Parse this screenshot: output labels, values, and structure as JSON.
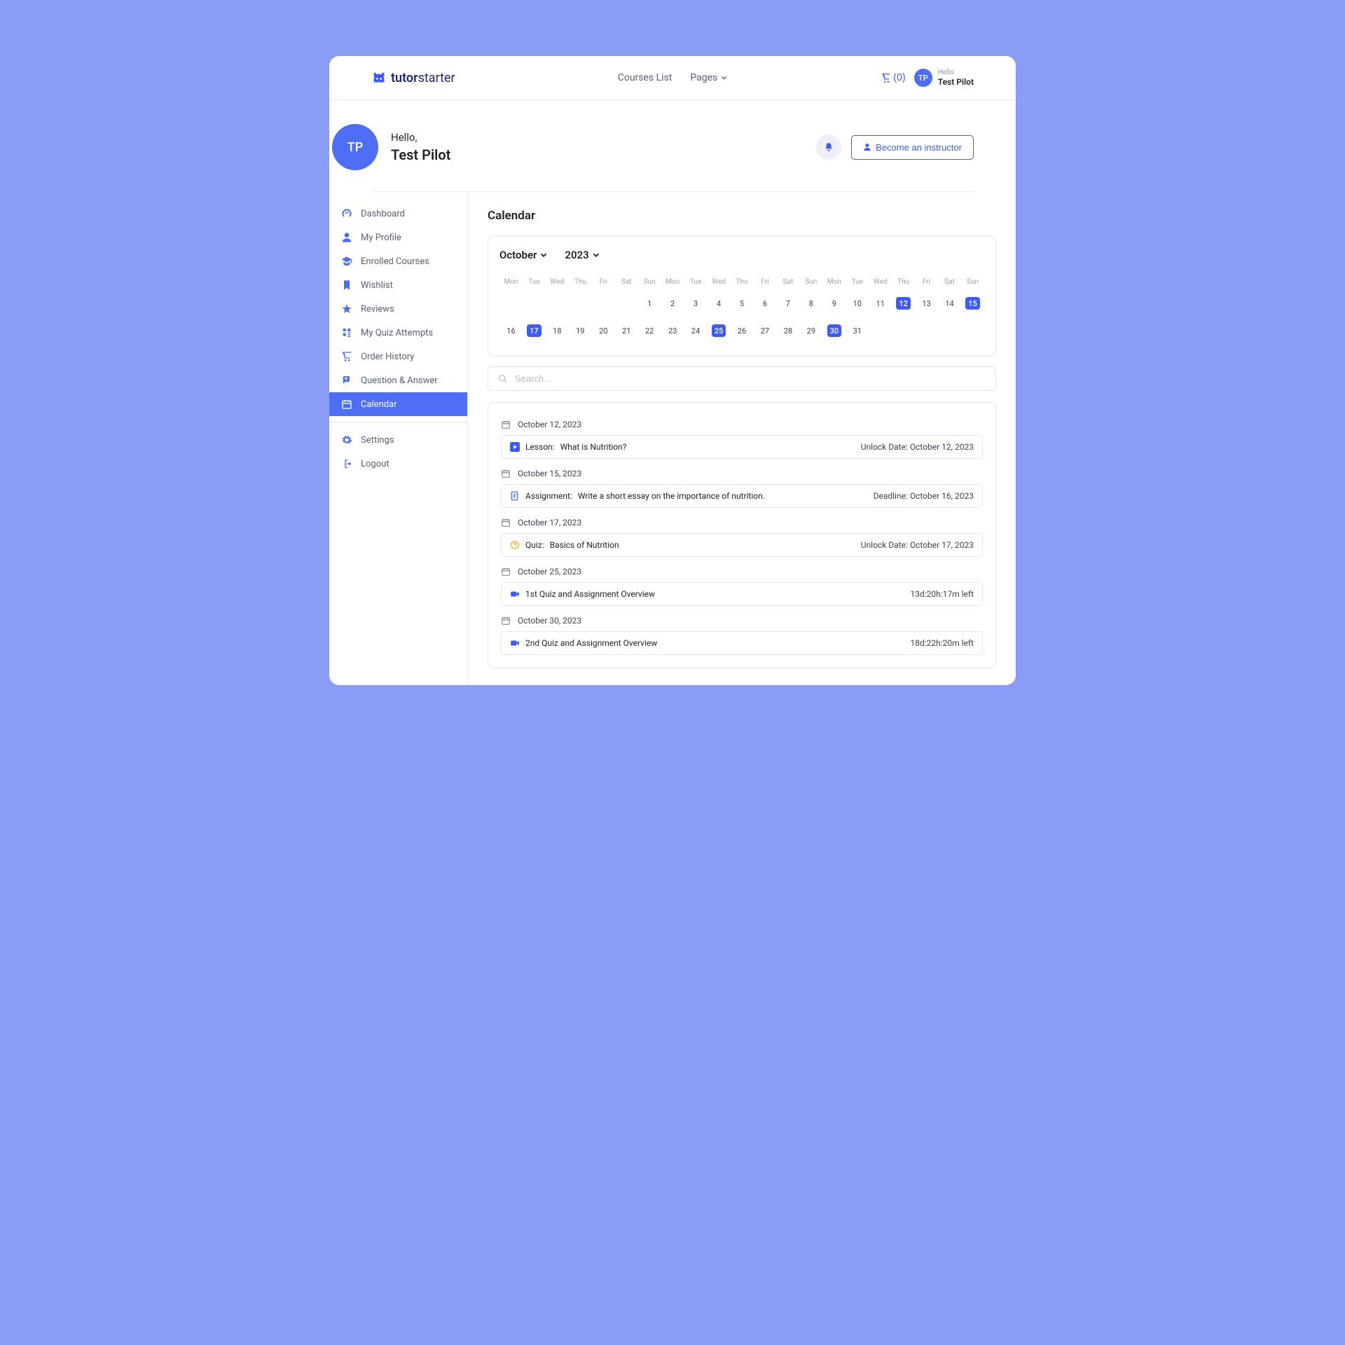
{
  "logo": {
    "bold": "tutor",
    "light": "starter"
  },
  "topnav": {
    "courses": "Courses List",
    "pages": "Pages"
  },
  "cart": {
    "count": "(0)"
  },
  "user": {
    "hello": "Hello",
    "name": "Test Pilot",
    "initials": "TP"
  },
  "profile": {
    "hello": "Hello,",
    "name": "Test Pilot",
    "initials": "TP",
    "become": "Become an instructor"
  },
  "sidebar": {
    "items": [
      {
        "label": "Dashboard"
      },
      {
        "label": "My Profile"
      },
      {
        "label": "Enrolled Courses"
      },
      {
        "label": "Wishlist"
      },
      {
        "label": "Reviews"
      },
      {
        "label": "My Quiz Attempts"
      },
      {
        "label": "Order History"
      },
      {
        "label": "Question & Answer"
      },
      {
        "label": "Calendar"
      },
      {
        "label": "Settings"
      },
      {
        "label": "Logout"
      }
    ]
  },
  "page": {
    "title": "Calendar"
  },
  "calendar": {
    "month": "October",
    "year": "2023",
    "weekdays": [
      "Mon",
      "Tue",
      "Wed",
      "Thu",
      "Fri",
      "Sat",
      "Sun",
      "Mon",
      "Tue",
      "Wed",
      "Thu",
      "Fri",
      "Sat",
      "Sun",
      "Mon",
      "Tue",
      "Wed",
      "Thu",
      "Fri",
      "Sat",
      "Sun"
    ],
    "row1": [
      "",
      "",
      "",
      "",
      "",
      "",
      "1",
      "2",
      "3",
      "4",
      "5",
      "6",
      "7",
      "8",
      "9",
      "10",
      "11",
      "12",
      "13",
      "14",
      "15"
    ],
    "row2": [
      "16",
      "17",
      "18",
      "19",
      "20",
      "21",
      "22",
      "23",
      "24",
      "25",
      "26",
      "27",
      "28",
      "29",
      "30",
      "31",
      "",
      "",
      "",
      "",
      ""
    ],
    "highlighted": [
      "12",
      "15",
      "17",
      "25",
      "30"
    ]
  },
  "search": {
    "placeholder": "Search..."
  },
  "events": [
    {
      "date": "October 12, 2023",
      "icon": "play",
      "type": "Lesson:",
      "title": "What is Nutrition?",
      "meta": "Unlock Date: October 12, 2023"
    },
    {
      "date": "October 15, 2023",
      "icon": "assignment",
      "type": "Assignment:",
      "title": "Write a short essay on the importance of nutrition.",
      "meta": "Deadline: October 16, 2023"
    },
    {
      "date": "October 17, 2023",
      "icon": "quiz",
      "type": "Quiz:",
      "title": "Basics of Nutrition",
      "meta": "Unlock Date: October 17, 2023"
    },
    {
      "date": "October 25, 2023",
      "icon": "video",
      "type": "",
      "title": "1st Quiz and Assignment Overview",
      "meta": "13d:20h:17m left"
    },
    {
      "date": "October 30, 2023",
      "icon": "video",
      "type": "",
      "title": "2nd Quiz and Assignment Overview",
      "meta": "18d:22h:20m left"
    }
  ],
  "colors": {
    "accent": "#3c5afe",
    "sidebar_active": "#4d6ef5"
  }
}
